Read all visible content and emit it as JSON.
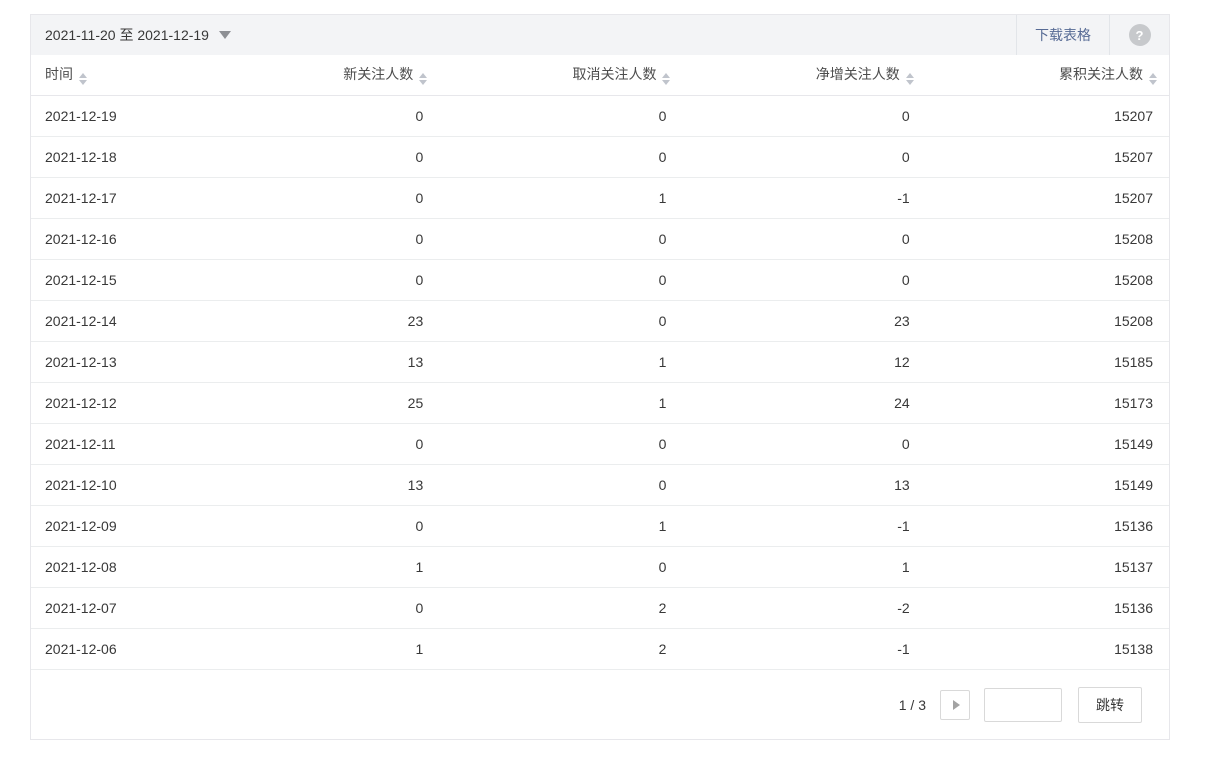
{
  "toolbar": {
    "date_range": "2021-11-20 至 2021-12-19",
    "download_label": "下载表格",
    "help_glyph": "?"
  },
  "table": {
    "columns": [
      "时间",
      "新关注人数",
      "取消关注人数",
      "净增关注人数",
      "累积关注人数"
    ],
    "rows": [
      [
        "2021-12-19",
        "0",
        "0",
        "0",
        "15207"
      ],
      [
        "2021-12-18",
        "0",
        "0",
        "0",
        "15207"
      ],
      [
        "2021-12-17",
        "0",
        "1",
        "-1",
        "15207"
      ],
      [
        "2021-12-16",
        "0",
        "0",
        "0",
        "15208"
      ],
      [
        "2021-12-15",
        "0",
        "0",
        "0",
        "15208"
      ],
      [
        "2021-12-14",
        "23",
        "0",
        "23",
        "15208"
      ],
      [
        "2021-12-13",
        "13",
        "1",
        "12",
        "15185"
      ],
      [
        "2021-12-12",
        "25",
        "1",
        "24",
        "15173"
      ],
      [
        "2021-12-11",
        "0",
        "0",
        "0",
        "15149"
      ],
      [
        "2021-12-10",
        "13",
        "0",
        "13",
        "15149"
      ],
      [
        "2021-12-09",
        "0",
        "1",
        "-1",
        "15136"
      ],
      [
        "2021-12-08",
        "1",
        "0",
        "1",
        "15137"
      ],
      [
        "2021-12-07",
        "0",
        "2",
        "-2",
        "15136"
      ],
      [
        "2021-12-06",
        "1",
        "2",
        "-1",
        "15138"
      ]
    ]
  },
  "pagination": {
    "page_indicator": "1 / 3",
    "jump_input_value": "",
    "jump_label": "跳转"
  },
  "colors": {
    "link_blue": "#576b95",
    "toolbar_bg": "#f3f4f6",
    "border": "#e7e7eb"
  }
}
